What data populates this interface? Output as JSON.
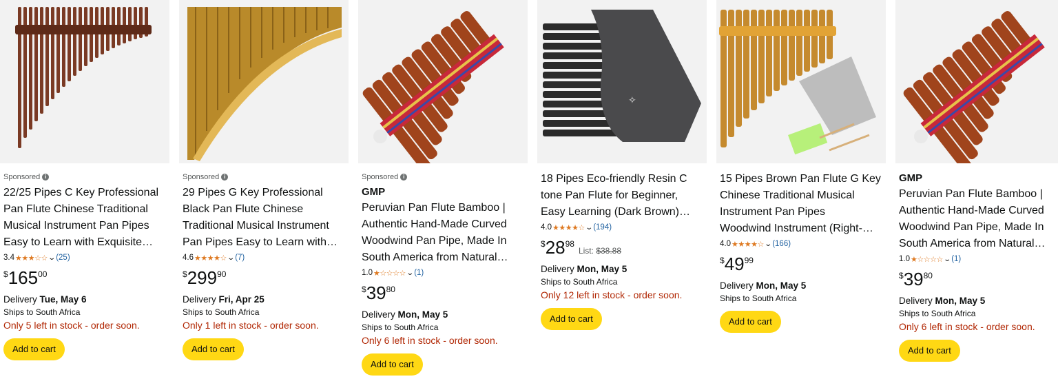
{
  "common": {
    "sponsored_label": "Sponsored",
    "info_glyph": "i",
    "delivery_prefix": "Delivery ",
    "ships_label": "Ships to South Africa",
    "add_to_cart": "Add to cart",
    "currency": "$",
    "list_prefix": "List: ",
    "star_color": "#de7921",
    "cta_color": "#ffd814",
    "stock_color": "#b12704"
  },
  "products": [
    {
      "sponsored": true,
      "brand": "",
      "title": "22/25 Pipes C Key Professional\nPan Flute Chinese Traditional\nMusical Instrument Pan Pipes\nEasy to Learn with Exquisite…",
      "rating": "3.4",
      "stars": "★★★☆☆",
      "reviews": "(25)",
      "price_whole": "165",
      "price_frac": "00",
      "list_price": "",
      "delivery_date": "Tue, May 6",
      "stock": "Only 5 left in stock - order soon."
    },
    {
      "sponsored": true,
      "brand": "",
      "title": "29 Pipes G Key Professional\nBlack Pan Flute Chinese\nTraditional Musical Instrument\nPan Pipes Easy to Learn with…",
      "rating": "4.6",
      "stars": "★★★★☆",
      "reviews": "(7)",
      "price_whole": "299",
      "price_frac": "90",
      "list_price": "",
      "delivery_date": "Fri, Apr 25",
      "stock": "Only 1 left in stock - order soon."
    },
    {
      "sponsored": true,
      "brand": "GMP",
      "title": "Peruvian Pan Flute Bamboo |\nAuthentic Hand-Made Curved\nWoodwind Pan Pipe, Made In\nSouth America from Natural…",
      "rating": "1.0",
      "stars": "★☆☆☆☆",
      "reviews": "(1)",
      "price_whole": "39",
      "price_frac": "80",
      "list_price": "",
      "delivery_date": "Mon, May 5",
      "stock": "Only 6 left in stock - order soon."
    },
    {
      "sponsored": false,
      "brand": "",
      "title": "18 Pipes Eco-friendly Resin C\ntone Pan Flute for Beginner,\nEasy Learning (Dark Brown)…",
      "rating": "4.0",
      "stars": "★★★★☆",
      "reviews": "(194)",
      "price_whole": "28",
      "price_frac": "98",
      "list_price": "$38.88",
      "delivery_date": "Mon, May 5",
      "stock": "Only 12 left in stock - order soon."
    },
    {
      "sponsored": false,
      "brand": "",
      "title": "15 Pipes Brown Pan Flute G Key\nChinese Traditional Musical\nInstrument Pan Pipes\nWoodwind Instrument (Right-…",
      "rating": "4.0",
      "stars": "★★★★☆",
      "reviews": "(166)",
      "price_whole": "49",
      "price_frac": "99",
      "list_price": "",
      "delivery_date": "Mon, May 5",
      "stock": ""
    },
    {
      "sponsored": false,
      "brand": "GMP",
      "title": "Peruvian Pan Flute Bamboo |\nAuthentic Hand-Made Curved\nWoodwind Pan Pipe, Made In\nSouth America from Natural…",
      "rating": "1.0",
      "stars": "★☆☆☆☆",
      "reviews": "(1)",
      "price_whole": "39",
      "price_frac": "80",
      "list_price": "",
      "delivery_date": "Mon, May 5",
      "stock": "Only 6 left in stock - order soon."
    }
  ]
}
